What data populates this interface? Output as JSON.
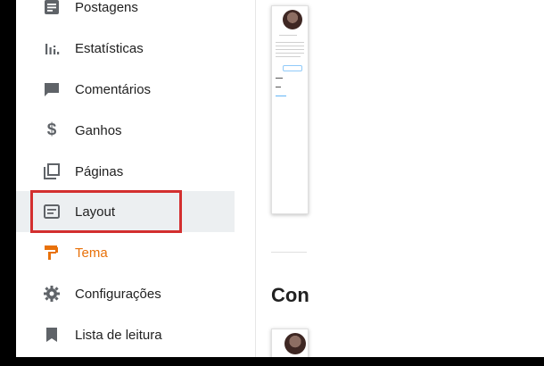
{
  "sidebar": {
    "items": [
      {
        "label": "Postagens",
        "icon": "posts-icon"
      },
      {
        "label": "Estatísticas",
        "icon": "stats-icon"
      },
      {
        "label": "Comentários",
        "icon": "comment-icon"
      },
      {
        "label": "Ganhos",
        "icon": "dollar-icon"
      },
      {
        "label": "Páginas",
        "icon": "pages-icon"
      },
      {
        "label": "Layout",
        "icon": "layout-icon",
        "active": true
      },
      {
        "label": "Tema",
        "icon": "theme-icon",
        "color": "#e8710a"
      },
      {
        "label": "Configurações",
        "icon": "gear-icon"
      },
      {
        "label": "Lista de leitura",
        "icon": "bookmark-icon"
      }
    ]
  },
  "main": {
    "section_heading": "Con"
  },
  "colors": {
    "accent_orange": "#e8710a",
    "highlight_red": "#d32f2f",
    "active_bg": "#eceff1",
    "icon_gray": "#5f6368"
  }
}
